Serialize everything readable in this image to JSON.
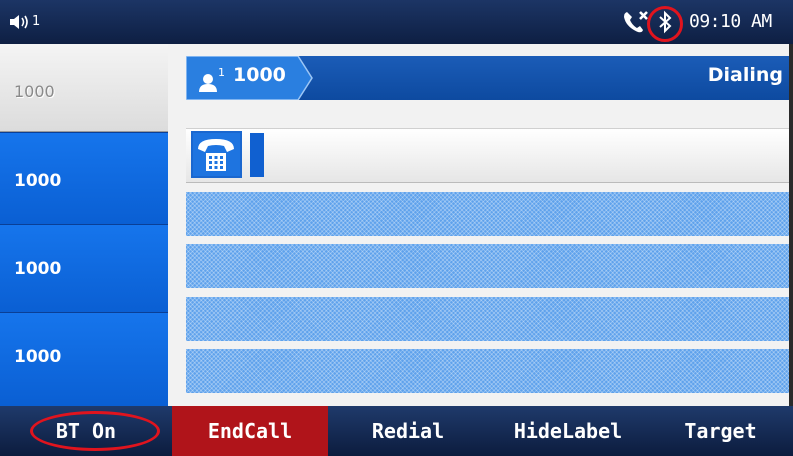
{
  "status_bar": {
    "volume_indicator": "1",
    "missed_call_icon": "missed-call-icon",
    "bluetooth_icon": "bluetooth-icon",
    "time": "09:10 AM",
    "highlight_color": "#e0141e"
  },
  "lines": [
    {
      "label": "1000",
      "state": "idle"
    },
    {
      "label": "1000",
      "state": "active"
    },
    {
      "label": "1000",
      "state": "active"
    },
    {
      "label": "1000",
      "state": "active"
    }
  ],
  "call": {
    "icon": "user-icon",
    "account_index": "1",
    "number": "1000",
    "status": "Dialing",
    "input_icon": "keypad-phone-icon",
    "input_value": ""
  },
  "softkeys": [
    {
      "label": "BT On"
    },
    {
      "label": "EndCall",
      "color": "#b0141a"
    },
    {
      "label": "Redial"
    },
    {
      "label": "HideLabel"
    },
    {
      "label": "Target"
    }
  ]
}
